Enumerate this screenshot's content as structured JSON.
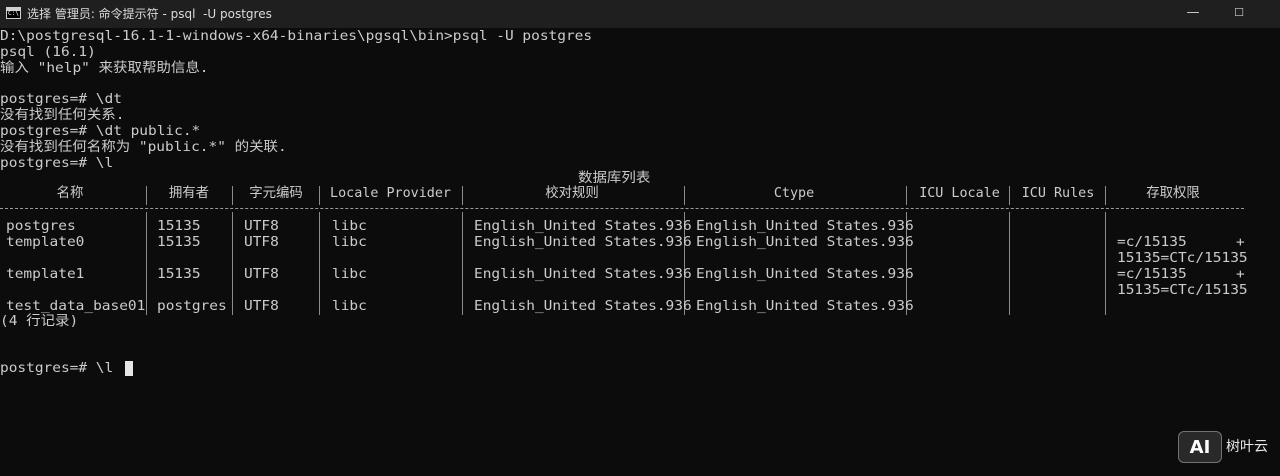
{
  "window": {
    "title": "选择 管理员: 命令提示符 - psql  -U postgres",
    "icon_text": "C:\\",
    "buttons": {
      "minimize": "—",
      "maximize": "☐",
      "close": "✕"
    }
  },
  "terminal": {
    "lines": [
      "D:\\postgresql-16.1-1-windows-x64-binaries\\pgsql\\bin>psql -U postgres",
      "psql (16.1)",
      "输入 \"help\" 来获取帮助信息.",
      "",
      "postgres=# \\dt",
      "没有找到任何关系.",
      "postgres=# \\dt public.*",
      "没有找到任何名称为 \"public.*\" 的关联.",
      "postgres=# \\l"
    ],
    "table": {
      "caption": "数据库列表",
      "headers": [
        "名称",
        "拥有者",
        "字元编码",
        "Locale Provider",
        "校对规则",
        "Ctype",
        "ICU Locale",
        "ICU Rules",
        "存取权限"
      ],
      "rows": [
        {
          "name": "postgres",
          "owner": "15135",
          "encoding": "UTF8",
          "provider": "libc",
          "collate": "English_United States.936",
          "ctype": "English_United States.936",
          "icu_locale": "",
          "icu_rules": "",
          "acl_1": "",
          "acl_2": "",
          "acl_plus": ""
        },
        {
          "name": "template0",
          "owner": "15135",
          "encoding": "UTF8",
          "provider": "libc",
          "collate": "English_United States.936",
          "ctype": "English_United States.936",
          "icu_locale": "",
          "icu_rules": "",
          "acl_1": "=c/15135",
          "acl_2": "15135=CTc/15135",
          "acl_plus": "+"
        },
        {
          "name": "template1",
          "owner": "15135",
          "encoding": "UTF8",
          "provider": "libc",
          "collate": "English_United States.936",
          "ctype": "English_United States.936",
          "icu_locale": "",
          "icu_rules": "",
          "acl_1": "=c/15135",
          "acl_2": "15135=CTc/15135",
          "acl_plus": "+"
        },
        {
          "name": "test_data_base01",
          "owner": "postgres",
          "encoding": "UTF8",
          "provider": "libc",
          "collate": "English_United States.936",
          "ctype": "English_United States.936",
          "icu_locale": "",
          "icu_rules": "",
          "acl_1": "",
          "acl_2": "",
          "acl_plus": ""
        }
      ],
      "footer": "(4 行记录)"
    },
    "prompt_line": "postgres=# \\l"
  },
  "watermark": {
    "logo": "AI",
    "text": "树叶云"
  },
  "colors": {
    "background": "#0c0c0c",
    "foreground": "#cccccc",
    "titlebar": "#1f1f1f"
  }
}
